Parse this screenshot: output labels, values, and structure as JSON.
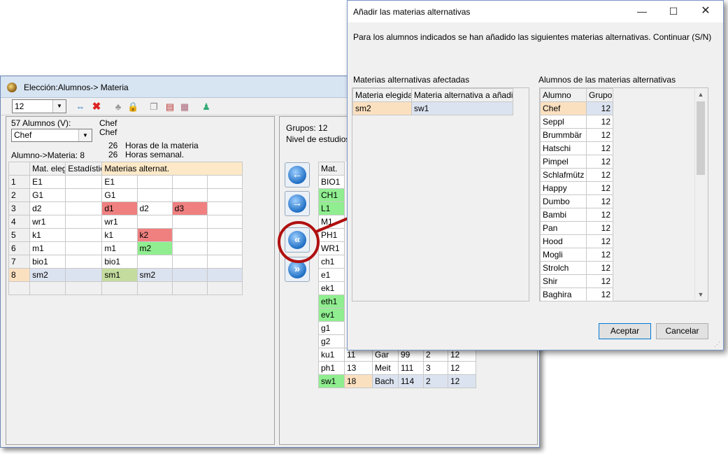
{
  "main_window": {
    "title": "Elección:Alumnos-> Materia",
    "class_combo": "12",
    "left": {
      "students_label": "57 Alumnos (V):",
      "student_combo": "Chef",
      "student_name_1": "Chef",
      "student_name_2": "Chef",
      "hours_subject_num": "26",
      "hours_subject_label": "Horas de la materia",
      "hours_week_num": "26",
      "hours_week_label": "Horas semanal.",
      "student_subject_label": "Alumno->Materia: 8",
      "grid_headers": [
        "",
        "Mat. eleg",
        "Estadístic",
        "Materias alternat.",
        "",
        "",
        ""
      ],
      "grid_rows": [
        [
          "1",
          "E1",
          "",
          "E1",
          "",
          "",
          ""
        ],
        [
          "2",
          "G1",
          "",
          "G1",
          "",
          "",
          ""
        ],
        [
          "3",
          "d2",
          "",
          "d1",
          "d2",
          "d3",
          ""
        ],
        [
          "4",
          "wr1",
          "",
          "wr1",
          "",
          "",
          ""
        ],
        [
          "5",
          "k1",
          "",
          "k1",
          "k2",
          "",
          ""
        ],
        [
          "6",
          "m1",
          "",
          "m1",
          "m2",
          "",
          ""
        ],
        [
          "7",
          "bio1",
          "",
          "bio1",
          "",
          "",
          ""
        ],
        [
          "8",
          "sm2",
          "",
          "sm1",
          "sm2",
          "",
          ""
        ],
        [
          "",
          "",
          "",
          "",
          "",
          "",
          ""
        ]
      ]
    },
    "right": {
      "groups_label": "Grupos: 12",
      "level_label": "Nivel de estudios:",
      "col_header": "Mat.",
      "subjects": [
        "BIO1",
        "CH1",
        "L1",
        "M1",
        "PH1",
        "WR1",
        "ch1",
        "e1",
        "ek1",
        "eth1",
        "ev1",
        "g1",
        "g2"
      ],
      "extra_rows": [
        [
          "ku1",
          "11",
          "Gar",
          "99",
          "2",
          "12"
        ],
        [
          "ph1",
          "13",
          "Meit",
          "111",
          "3",
          "12"
        ],
        [
          "sw1",
          "18",
          "Bach",
          "114",
          "2",
          "12"
        ]
      ]
    }
  },
  "dialog": {
    "title": "Añadir las materias alternativas",
    "message": "Para los alumnos indicados se han añadido las siguientes materias alternativas. Continuar (S/N)",
    "affected_label": "Materias alternativas afectadas",
    "affected_headers": [
      "Materia elegida",
      "Materia alternativa a añadir"
    ],
    "affected_rows": [
      [
        "sm2",
        "sw1"
      ]
    ],
    "students_label": "Alumnos de las materias alternativas",
    "student_headers": [
      "Alumno",
      "Grupo"
    ],
    "student_rows": [
      [
        "Chef",
        "12"
      ],
      [
        "Seppl",
        "12"
      ],
      [
        "Brummbär",
        "12"
      ],
      [
        "Hatschi",
        "12"
      ],
      [
        "Pimpel",
        "12"
      ],
      [
        "Schlafmütz",
        "12"
      ],
      [
        "Happy",
        "12"
      ],
      [
        "Dumbo",
        "12"
      ],
      [
        "Bambi",
        "12"
      ],
      [
        "Pan",
        "12"
      ],
      [
        "Hood",
        "12"
      ],
      [
        "Mogli",
        "12"
      ],
      [
        "Strolch",
        "12"
      ],
      [
        "Shir",
        "12"
      ],
      [
        "Baghira",
        "12"
      ]
    ],
    "accept_label": "Aceptar",
    "cancel_label": "Cancelar"
  },
  "colors": {
    "highlight_red": "#f08080",
    "highlight_green": "#90ee90",
    "selected_row": "#dce3f0",
    "annotation_red": "#b01010"
  },
  "icons": [
    "app-icon",
    "swap-arrows-icon",
    "delete-x-icon",
    "tree-icon",
    "lock-icon",
    "copy-windows-icon",
    "remove-doc-icon",
    "settings-icon",
    "people-icon",
    "arrow-left-icon",
    "arrow-right-icon",
    "arrow-double-left-icon",
    "arrow-double-right-icon",
    "minimize-icon",
    "maximize-icon",
    "close-icon"
  ]
}
